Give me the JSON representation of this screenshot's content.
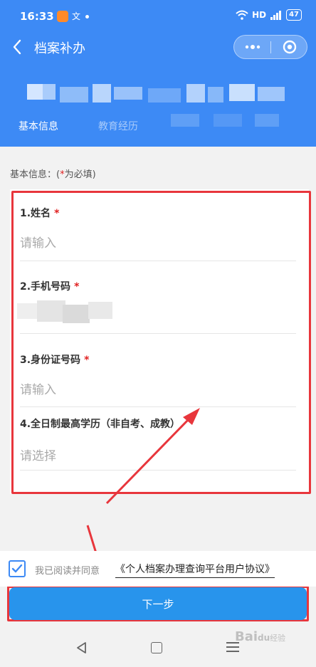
{
  "status_bar": {
    "time": "16:33",
    "app_text": "文",
    "network": "HD",
    "battery": "47"
  },
  "nav": {
    "title": "档案补办"
  },
  "tabs": [
    {
      "label": "基本信息"
    },
    {
      "label": "教育经历"
    }
  ],
  "section": {
    "prefix": "基本信息：(",
    "star": "*",
    "suffix": "为必填)"
  },
  "form": {
    "required_mark": "*",
    "fields": [
      {
        "label": "1.姓名",
        "placeholder": "请输入",
        "value": ""
      },
      {
        "label": "2.手机号码",
        "placeholder": "",
        "value": ""
      },
      {
        "label": "3.身份证号码",
        "placeholder": "请输入",
        "value": ""
      },
      {
        "label": "4.全日制最高学历（非自考、成教）",
        "placeholder": "请选择",
        "value": ""
      }
    ]
  },
  "agreement": {
    "text": "我已阅读并同意",
    "link": "《个人档案办理查询平台用户协议》",
    "checked": true
  },
  "next_button": {
    "label": "下一步"
  },
  "watermark": {
    "brand": "Bai",
    "paw": "du",
    "suffix": "经验"
  },
  "colors": {
    "header": "#3d8af5",
    "button": "#2894ec",
    "annotation": "#e8363c",
    "required": "#e02020"
  }
}
